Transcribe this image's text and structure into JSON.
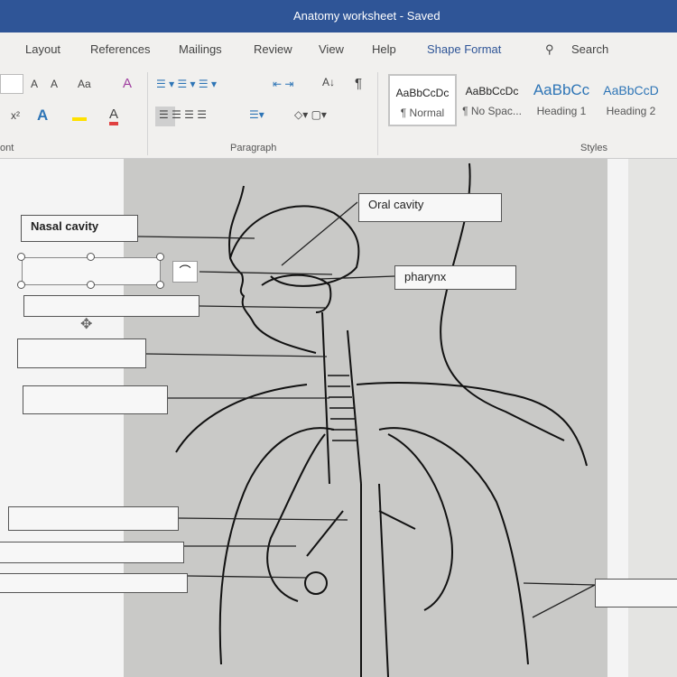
{
  "window": {
    "title": "Anatomy worksheet - Saved"
  },
  "tabs": [
    {
      "label": "Layout"
    },
    {
      "label": "References"
    },
    {
      "label": "Mailings"
    },
    {
      "label": "Review"
    },
    {
      "label": "View"
    },
    {
      "label": "Help"
    },
    {
      "label": "Shape Format",
      "active": true
    }
  ],
  "search": {
    "label": "Search",
    "icon": "search-icon"
  },
  "ribbon": {
    "groups": {
      "font": "ont",
      "paragraph": "Paragraph",
      "styles": "Styles"
    },
    "font_buttons": {
      "grow": "A",
      "shrink": "A",
      "case": "Aa",
      "superscript": "x²",
      "text_effect": "A",
      "font_color": "A"
    },
    "styles": [
      {
        "preview": "AaBbCcDc",
        "name": "¶ Normal",
        "selected": true
      },
      {
        "preview": "AaBbCcDc",
        "name": "¶ No Spac..."
      },
      {
        "preview": "AaBbCc",
        "name": "Heading 1"
      },
      {
        "preview": "AaBbCcD",
        "name": "Heading 2"
      }
    ]
  },
  "labels": {
    "nasal": "Nasal cavity",
    "oral": "Oral cavity",
    "pharynx": "pharynx"
  },
  "colors": {
    "titlebar": "#2f5597",
    "accent": "#2f5597"
  }
}
